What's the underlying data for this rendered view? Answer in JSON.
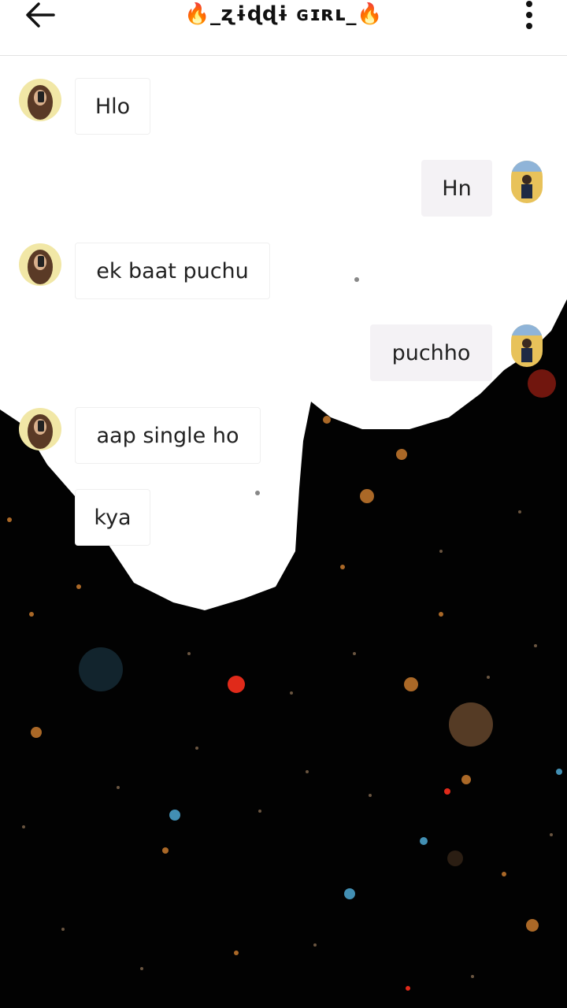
{
  "header": {
    "title": "🔥_ʐɨɖɖɨ ɢɪʀʟ_🔥",
    "back_icon": "arrow-left-icon",
    "more_icon": "more-vertical-icon"
  },
  "messages": [
    {
      "sender": "other",
      "text": "Hlo"
    },
    {
      "sender": "me",
      "text": "Hn"
    },
    {
      "sender": "other",
      "text": "ek baat puchu"
    },
    {
      "sender": "me",
      "text": "puchho"
    },
    {
      "sender": "other",
      "text": "aap single ho"
    },
    {
      "sender": "other",
      "text": "kya"
    }
  ],
  "colors": {
    "background": "#ffffff",
    "overlay_dark": "#000000",
    "bubble_mine": "#f4f2f5",
    "text": "#222222"
  }
}
